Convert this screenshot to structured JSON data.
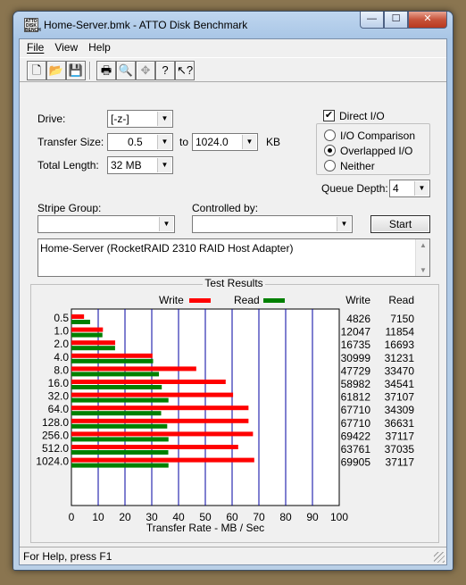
{
  "window": {
    "title": "Home-Server.bmk - ATTO Disk Benchmark",
    "icon_text": "ATTO DISK BENCH",
    "minimize": "—",
    "maximize": "☐",
    "close": "✕"
  },
  "menu": {
    "file": "File",
    "view": "View",
    "help": "Help"
  },
  "toolbar": {
    "buttons": [
      "new-file-icon",
      "open-folder-icon",
      "save-icon",
      "print-icon",
      "print-preview-icon",
      "move-icon",
      "help-icon",
      "context-help-icon"
    ]
  },
  "form": {
    "drive_label": "Drive:",
    "drive_value": "[-z-]",
    "transfer_size_label": "Transfer Size:",
    "transfer_from": "0.5",
    "to_label": "to",
    "transfer_to": "1024.0",
    "kb_label": "KB",
    "total_length_label": "Total Length:",
    "total_length_value": "32 MB",
    "direct_io_label": "Direct I/O",
    "direct_io_checked": true,
    "io_comparison_label": "I/O Comparison",
    "overlapped_io_label": "Overlapped I/O",
    "neither_label": "Neither",
    "selected_mode": "overlapped",
    "queue_depth_label": "Queue Depth:",
    "queue_depth_value": "4",
    "stripe_group_label": "Stripe Group:",
    "stripe_group_value": "",
    "controlled_by_label": "Controlled by:",
    "controlled_by_value": "",
    "start_label": "Start",
    "description": "Home-Server (RocketRAID 2310 RAID Host Adapter)"
  },
  "results": {
    "title": "Test Results",
    "write_legend": "Write",
    "read_legend": "Read",
    "write_header": "Write",
    "read_header": "Read",
    "write_color": "#ff0000",
    "read_color": "#008000",
    "grid_color": "#0000a0"
  },
  "chart_data": {
    "type": "bar",
    "orientation": "horizontal",
    "categories": [
      "0.5",
      "1.0",
      "2.0",
      "4.0",
      "8.0",
      "16.0",
      "32.0",
      "64.0",
      "128.0",
      "256.0",
      "512.0",
      "1024.0"
    ],
    "series": [
      {
        "name": "Write",
        "values": [
          4826,
          12047,
          16735,
          30999,
          47729,
          58982,
          61812,
          67710,
          67710,
          69422,
          63761,
          69905
        ]
      },
      {
        "name": "Read",
        "values": [
          7150,
          11854,
          16693,
          31231,
          33470,
          34541,
          37107,
          34309,
          36631,
          37117,
          37035,
          37117
        ]
      }
    ],
    "x_ticks": [
      "0",
      "10",
      "20",
      "30",
      "40",
      "50",
      "60",
      "70",
      "80",
      "90",
      "100"
    ],
    "xlim": [
      0,
      100
    ],
    "xlabel": "Transfer Rate - MB / Sec",
    "legend": "top"
  },
  "status": {
    "text": "For Help, press F1"
  }
}
